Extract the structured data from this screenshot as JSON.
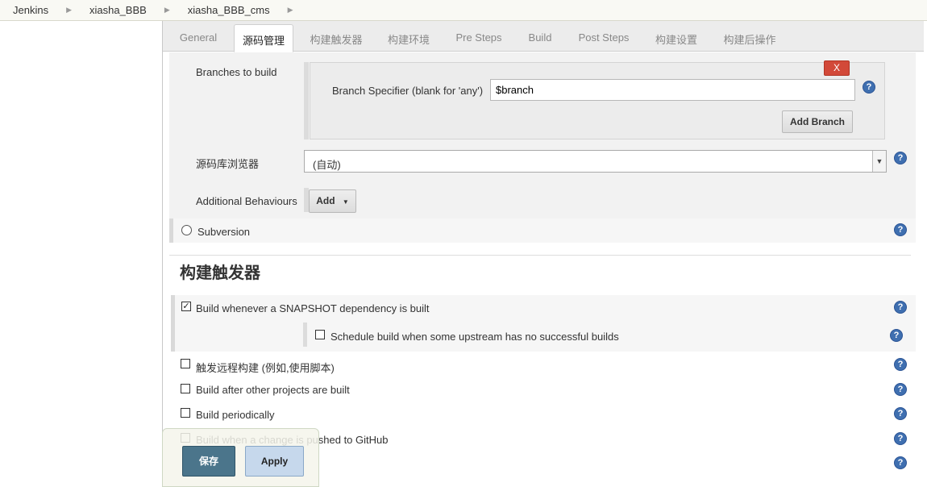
{
  "breadcrumb": [
    "Jenkins",
    "xiasha_BBB",
    "xiasha_BBB_cms"
  ],
  "tabs": [
    {
      "label": "General"
    },
    {
      "label": "源码管理"
    },
    {
      "label": "构建触发器"
    },
    {
      "label": "构建环境"
    },
    {
      "label": "Pre Steps"
    },
    {
      "label": "Build"
    },
    {
      "label": "Post Steps"
    },
    {
      "label": "构建设置"
    },
    {
      "label": "构建后操作"
    }
  ],
  "active_tab": "源码管理",
  "scm": {
    "branches_label": "Branches to build",
    "delete_label": "X",
    "branch_specifier_label": "Branch Specifier (blank for 'any')",
    "branch_specifier_value": "$branch",
    "add_branch_label": "Add Branch",
    "browser_label": "源码库浏览器",
    "browser_value": "(自动)",
    "additional_label": "Additional Behaviours",
    "add_label": "Add",
    "subversion_label": "Subversion"
  },
  "triggers": {
    "title": "构建触发器",
    "items": [
      {
        "label": "Build whenever a SNAPSHOT dependency is built",
        "checked": true
      },
      {
        "label": "Schedule build when some upstream has no successful builds",
        "checked": false
      },
      {
        "label": "触发远程构建 (例如,使用脚本)",
        "checked": false
      },
      {
        "label": "Build after other projects are built",
        "checked": false
      },
      {
        "label": "Build periodically",
        "checked": false
      },
      {
        "label": "Build when a change is pushed to GitHub",
        "checked": false
      }
    ]
  },
  "footer": {
    "save_label": "保存",
    "apply_label": "Apply"
  },
  "help_icon_glyph": "?",
  "colors": {
    "accent": "#4b758b",
    "delete": "#d24939",
    "help": "#3f6fb0"
  }
}
